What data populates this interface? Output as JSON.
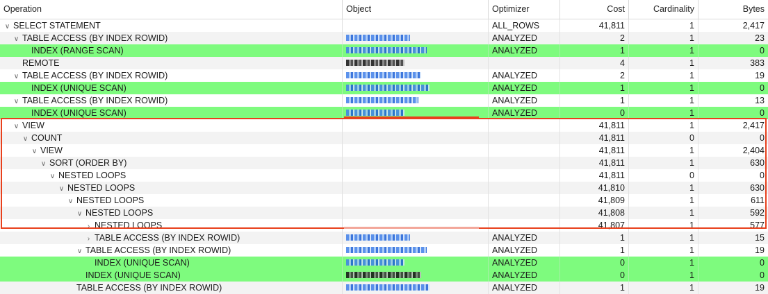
{
  "headers": {
    "operation": "Operation",
    "object": "Object",
    "optimizer": "Optimizer",
    "cost": "Cost",
    "cardinality": "Cardinality",
    "bytes": "Bytes"
  },
  "colors": {
    "highlight_row": "#7efb7e",
    "selection_box": "#e8401c"
  },
  "rows": [
    {
      "indent": 0,
      "twisty": "open",
      "operation": "SELECT STATEMENT",
      "object": "",
      "optimizer": "ALL_ROWS",
      "cost": "41,811",
      "cardinality": "1",
      "bytes": "2,417",
      "highlight": false
    },
    {
      "indent": 1,
      "twisty": "open",
      "operation": "TABLE ACCESS (BY INDEX ROWID)",
      "object": "redacted",
      "optimizer": "ANALYZED",
      "cost": "2",
      "cardinality": "1",
      "bytes": "23",
      "highlight": false
    },
    {
      "indent": 2,
      "twisty": "none",
      "operation": "INDEX (RANGE SCAN)",
      "object": "redacted",
      "optimizer": "ANALYZED",
      "cost": "1",
      "cardinality": "1",
      "bytes": "0",
      "highlight": true
    },
    {
      "indent": 1,
      "twisty": "none",
      "operation": "REMOTE",
      "object": "redacted-dark",
      "optimizer": "",
      "cost": "4",
      "cardinality": "1",
      "bytes": "383",
      "highlight": false
    },
    {
      "indent": 1,
      "twisty": "open",
      "operation": "TABLE ACCESS (BY INDEX ROWID)",
      "object": "redacted",
      "optimizer": "ANALYZED",
      "cost": "2",
      "cardinality": "1",
      "bytes": "19",
      "highlight": false
    },
    {
      "indent": 2,
      "twisty": "none",
      "operation": "INDEX (UNIQUE SCAN)",
      "object": "redacted",
      "optimizer": "ANALYZED",
      "cost": "1",
      "cardinality": "1",
      "bytes": "0",
      "highlight": true
    },
    {
      "indent": 1,
      "twisty": "open",
      "operation": "TABLE ACCESS (BY INDEX ROWID)",
      "object": "redacted",
      "optimizer": "ANALYZED",
      "cost": "1",
      "cardinality": "1",
      "bytes": "13",
      "highlight": false
    },
    {
      "indent": 2,
      "twisty": "none",
      "operation": "INDEX (UNIQUE SCAN)",
      "object": "redacted",
      "optimizer": "ANALYZED",
      "cost": "0",
      "cardinality": "1",
      "bytes": "0",
      "highlight": true
    },
    {
      "indent": 1,
      "twisty": "open",
      "operation": "VIEW",
      "object": "",
      "optimizer": "",
      "cost": "41,811",
      "cardinality": "1",
      "bytes": "2,417",
      "highlight": false
    },
    {
      "indent": 2,
      "twisty": "open",
      "operation": "COUNT",
      "object": "",
      "optimizer": "",
      "cost": "41,811",
      "cardinality": "0",
      "bytes": "0",
      "highlight": false
    },
    {
      "indent": 3,
      "twisty": "open",
      "operation": "VIEW",
      "object": "",
      "optimizer": "",
      "cost": "41,811",
      "cardinality": "1",
      "bytes": "2,404",
      "highlight": false
    },
    {
      "indent": 4,
      "twisty": "open",
      "operation": "SORT (ORDER BY)",
      "object": "",
      "optimizer": "",
      "cost": "41,811",
      "cardinality": "1",
      "bytes": "630",
      "highlight": false
    },
    {
      "indent": 5,
      "twisty": "open",
      "operation": "NESTED LOOPS",
      "object": "",
      "optimizer": "",
      "cost": "41,811",
      "cardinality": "0",
      "bytes": "0",
      "highlight": false
    },
    {
      "indent": 6,
      "twisty": "open",
      "operation": "NESTED LOOPS",
      "object": "",
      "optimizer": "",
      "cost": "41,810",
      "cardinality": "1",
      "bytes": "630",
      "highlight": false
    },
    {
      "indent": 7,
      "twisty": "open",
      "operation": "NESTED LOOPS",
      "object": "",
      "optimizer": "",
      "cost": "41,809",
      "cardinality": "1",
      "bytes": "611",
      "highlight": false
    },
    {
      "indent": 8,
      "twisty": "open",
      "operation": "NESTED LOOPS",
      "object": "",
      "optimizer": "",
      "cost": "41,808",
      "cardinality": "1",
      "bytes": "592",
      "highlight": false
    },
    {
      "indent": 9,
      "twisty": "closed",
      "operation": "NESTED LOOPS",
      "object": "",
      "optimizer": "",
      "cost": "41,807",
      "cardinality": "1",
      "bytes": "577",
      "highlight": false
    },
    {
      "indent": 9,
      "twisty": "closed",
      "operation": "TABLE ACCESS (BY INDEX ROWID)",
      "object": "redacted",
      "optimizer": "ANALYZED",
      "cost": "1",
      "cardinality": "1",
      "bytes": "15",
      "highlight": false
    },
    {
      "indent": 8,
      "twisty": "open",
      "operation": "TABLE ACCESS (BY INDEX ROWID)",
      "object": "redacted",
      "optimizer": "ANALYZED",
      "cost": "1",
      "cardinality": "1",
      "bytes": "19",
      "highlight": false
    },
    {
      "indent": 9,
      "twisty": "none",
      "operation": "INDEX (UNIQUE SCAN)",
      "object": "redacted",
      "optimizer": "ANALYZED",
      "cost": "0",
      "cardinality": "1",
      "bytes": "0",
      "highlight": true
    },
    {
      "indent": 8,
      "twisty": "none",
      "operation": "INDEX (UNIQUE SCAN)",
      "object": "redacted-dark",
      "optimizer": "ANALYZED",
      "cost": "0",
      "cardinality": "1",
      "bytes": "0",
      "highlight": true
    },
    {
      "indent": 7,
      "twisty": "none",
      "operation": "TABLE ACCESS (BY INDEX ROWID)",
      "object": "redacted",
      "optimizer": "ANALYZED",
      "cost": "1",
      "cardinality": "1",
      "bytes": "19",
      "highlight": false
    }
  ]
}
